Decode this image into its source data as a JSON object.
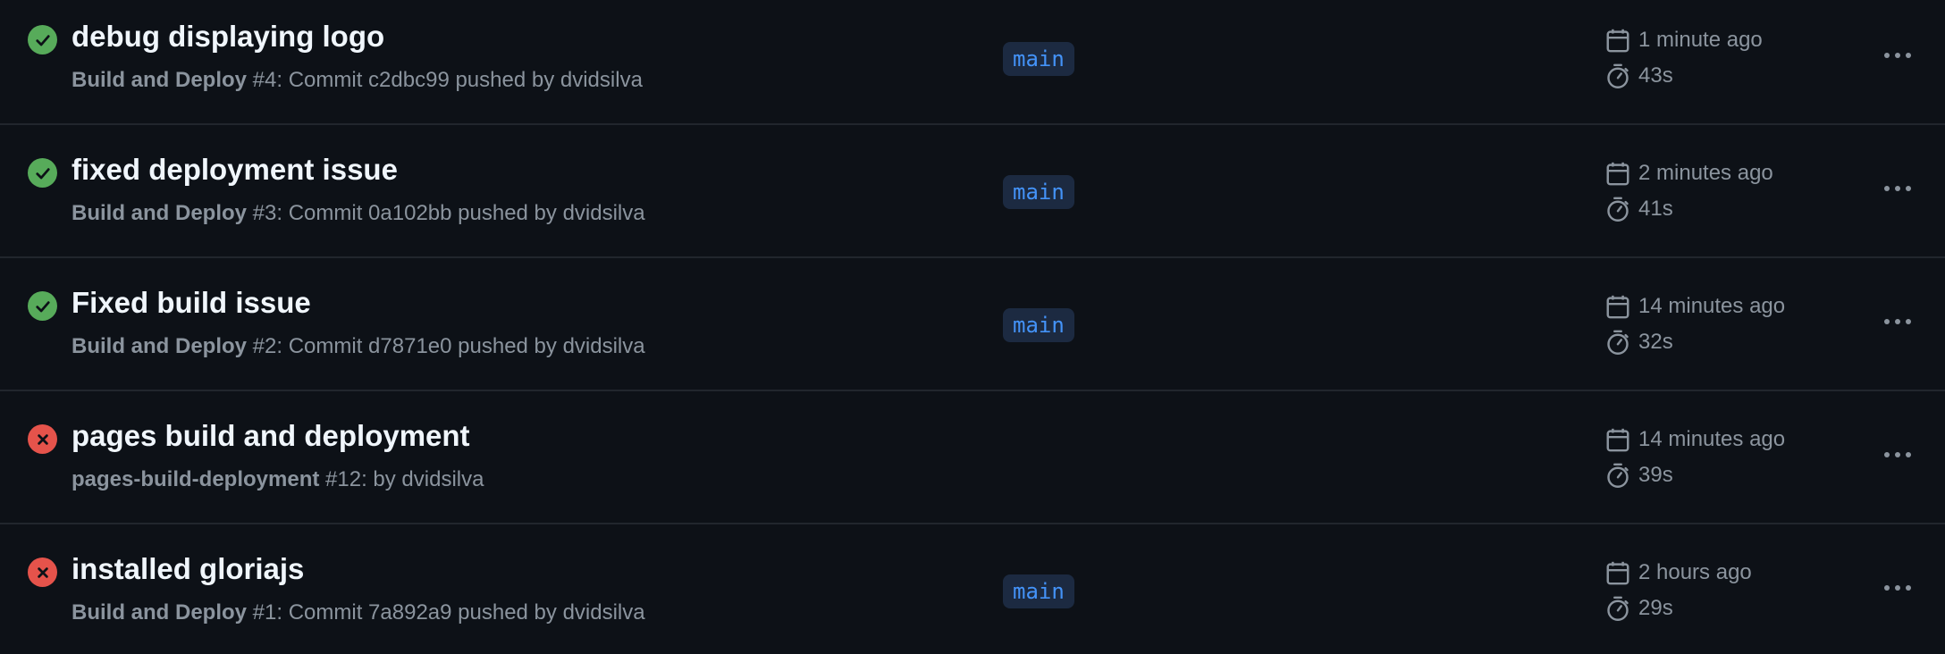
{
  "runs": [
    {
      "status": "success",
      "title": "debug displaying logo",
      "workflow": "Build and Deploy",
      "detail": " #4: Commit c2dbc99 pushed by dvidsilva",
      "branch": "main",
      "time": "1 minute ago",
      "duration": "43s"
    },
    {
      "status": "success",
      "title": "fixed deployment issue",
      "workflow": "Build and Deploy",
      "detail": " #3: Commit 0a102bb pushed by dvidsilva",
      "branch": "main",
      "time": "2 minutes ago",
      "duration": "41s"
    },
    {
      "status": "success",
      "title": "Fixed build issue",
      "workflow": "Build and Deploy",
      "detail": " #2: Commit d7871e0 pushed by dvidsilva",
      "branch": "main",
      "time": "14 minutes ago",
      "duration": "32s"
    },
    {
      "status": "failure",
      "title": "pages build and deployment",
      "workflow": "pages-build-deployment",
      "detail": " #12: by dvidsilva",
      "branch": "",
      "time": "14 minutes ago",
      "duration": "39s"
    },
    {
      "status": "failure",
      "title": "installed gloriajs",
      "workflow": "Build and Deploy",
      "detail": " #1: Commit 7a892a9 pushed by dvidsilva",
      "branch": "main",
      "time": "2 hours ago",
      "duration": "29s"
    }
  ],
  "icons": {
    "success": "check-circle-icon",
    "failure": "x-circle-icon",
    "time": "calendar-icon",
    "duration": "stopwatch-icon",
    "more": "kebab-horizontal-icon"
  },
  "colors": {
    "background": "#0d1117",
    "success": "#57ab5a",
    "failure": "#e5534b",
    "branch_text": "#4493f8",
    "branch_bg": "#1c2a41"
  }
}
